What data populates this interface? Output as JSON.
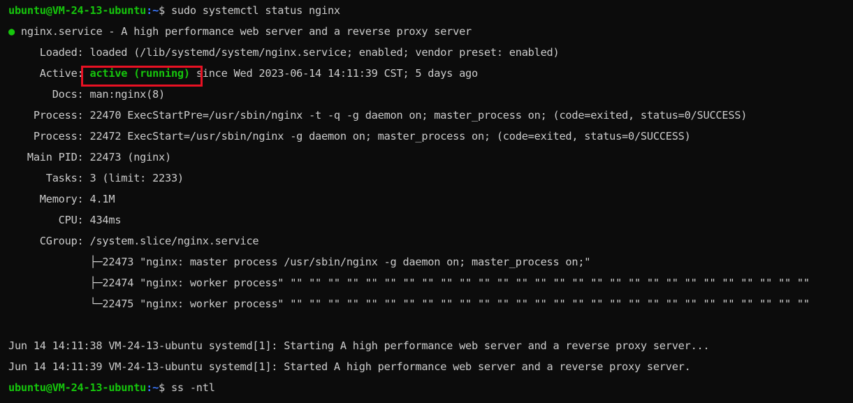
{
  "terminal": {
    "prompt_user_host": "ubuntu@VM-24-13-ubuntu",
    "prompt_path": ":~",
    "prompt_symbol": "$ ",
    "command1": "sudo systemctl status nginx",
    "command2": "ss -ntl",
    "service_dot": "●",
    "service_line": " nginx.service - A high performance web server and a reverse proxy server",
    "loaded_key": "     Loaded: ",
    "loaded_val": "loaded (/lib/systemd/system/nginx.service; enabled; vendor preset: enabled)",
    "active_key": "     Active: ",
    "active_status": "active (running)",
    "active_rest": " since Wed 2023-06-14 14:11:39 CST; 5 days ago",
    "docs_key": "       Docs: ",
    "docs_val": "man:nginx(8)",
    "process1_key": "    Process: ",
    "process1_val": "22470 ExecStartPre=/usr/sbin/nginx -t -q -g daemon on; master_process on; (code=exited, status=0/SUCCESS)",
    "process2_key": "    Process: ",
    "process2_val": "22472 ExecStart=/usr/sbin/nginx -g daemon on; master_process on; (code=exited, status=0/SUCCESS)",
    "mainpid_key": "   Main PID: ",
    "mainpid_val": "22473 (nginx)",
    "tasks_key": "      Tasks: ",
    "tasks_val": "3 (limit: 2233)",
    "memory_key": "     Memory: ",
    "memory_val": "4.1M",
    "cpu_key": "        CPU: ",
    "cpu_val": "434ms",
    "cgroup_key": "     CGroup: ",
    "cgroup_val": "/system.slice/nginx.service",
    "cgroup_children": [
      {
        "branch": "             ├─",
        "text": "22473 \"nginx: master process /usr/sbin/nginx -g daemon on; master_process on;\""
      },
      {
        "branch": "             ├─",
        "text": "22474 \"nginx: worker process\" \"\" \"\" \"\" \"\" \"\" \"\" \"\" \"\" \"\" \"\" \"\" \"\" \"\" \"\" \"\" \"\" \"\" \"\" \"\" \"\" \"\" \"\" \"\" \"\" \"\" \"\" \"\" \"\""
      },
      {
        "branch": "             └─",
        "text": "22475 \"nginx: worker process\" \"\" \"\" \"\" \"\" \"\" \"\" \"\" \"\" \"\" \"\" \"\" \"\" \"\" \"\" \"\" \"\" \"\" \"\" \"\" \"\" \"\" \"\" \"\" \"\" \"\" \"\" \"\" \"\""
      }
    ],
    "log1": "Jun 14 14:11:38 VM-24-13-ubuntu systemd[1]: Starting A high performance web server and a reverse proxy server...",
    "log2": "Jun 14 14:11:39 VM-24-13-ubuntu systemd[1]: Started A high performance web server and a reverse proxy server."
  },
  "colors": {
    "background": "#0c0c0c",
    "text": "#cccccc",
    "prompt_user": "#16c60c",
    "prompt_path": "#3b78ff",
    "active": "#16c60c",
    "highlight_box": "#e81123"
  }
}
